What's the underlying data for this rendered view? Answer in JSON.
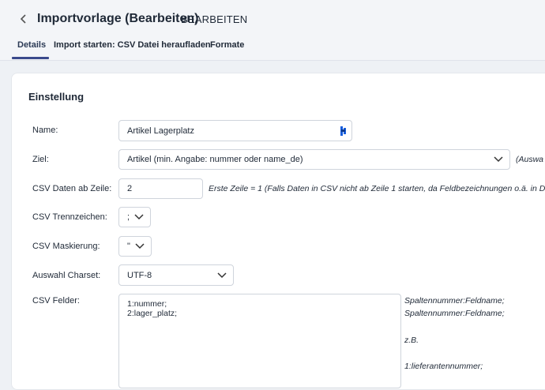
{
  "header": {
    "title": "Importvorlage (Bearbeiten)",
    "subtitle": "BEARBEITEN"
  },
  "tabs": [
    {
      "label": "Details",
      "active": true
    },
    {
      "label": "Import starten: CSV Datei heraufladen",
      "active": false
    },
    {
      "label": "Formate",
      "active": false
    }
  ],
  "section": {
    "title": "Einstellung"
  },
  "form": {
    "name": {
      "label": "Name:",
      "value": "Artikel Lagerplatz"
    },
    "ziel": {
      "label": "Ziel:",
      "value": "Artikel (min. Angabe: nummer oder name_de)",
      "hint": "(Auswa"
    },
    "csv_start": {
      "label": "CSV Daten ab Zeile:",
      "value": "2",
      "hint": "Erste Zeile = 1 (Falls Daten in CSV nicht ab Zeile 1 starten, da Feldbezeichnungen o.ä. in Do"
    },
    "separator": {
      "label": "CSV Trennzeichen:",
      "value": ";"
    },
    "masking": {
      "label": "CSV Maskierung:",
      "value": "\""
    },
    "charset": {
      "label": "Auswahl Charset:",
      "value": "UTF-8"
    },
    "fields": {
      "label": "CSV Felder:",
      "lines": [
        "1:nummer;",
        "2:lager_platz;"
      ],
      "help": [
        "Spaltennummer:Feldname;",
        "Spaltennummer:Feldname;",
        "",
        "z.B.",
        "",
        "1:lieferantennummer;"
      ]
    }
  },
  "colors": {
    "accent": "#3a4a8c",
    "background": "#eef1f5",
    "card": "#ffffff"
  },
  "icons": {
    "back": "chevron-left-icon",
    "select": "chevron-down-icon",
    "input_extension": "bitwarden-icon"
  }
}
